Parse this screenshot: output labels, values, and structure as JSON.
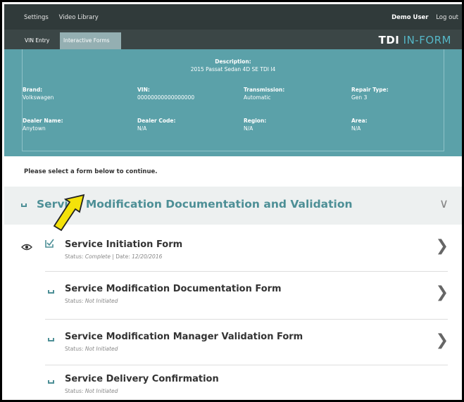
{
  "topbar": {
    "settings": "Settings",
    "video_library": "Video Library",
    "user": "Demo User",
    "logout": "Log out"
  },
  "tabs": {
    "vin_entry": "VIN Entry",
    "interactive_forms": "Interactive Forms"
  },
  "brand": {
    "part1": "TDI",
    "part2": "IN-FORM"
  },
  "vehicle": {
    "description_label": "Description:",
    "description": "2015 Passat Sedan 4D SE TDI I4",
    "brand_label": "Brand:",
    "brand": "Volkswagen",
    "vin_label": "VIN:",
    "vin": "00000000000000000",
    "transmission_label": "Transmission:",
    "transmission": "Automatic",
    "repair_type_label": "Repair Type:",
    "repair_type": "Gen 3",
    "dealer_name_label": "Dealer Name:",
    "dealer_name": "Anytown",
    "dealer_code_label": "Dealer Code:",
    "dealer_code": "N/A",
    "region_label": "Region:",
    "region": "N/A",
    "area_label": "Area:",
    "area": "N/A"
  },
  "prompt": "Please select a form below to continue.",
  "section_title": "Service Modification Documentation and Validation",
  "forms": [
    {
      "title": "Service Initiation Form",
      "status_prefix": "Status:",
      "status": "Complete",
      "date_prefix": "| Date:",
      "date": "12/20/2016"
    },
    {
      "title": "Service Modification Documentation Form",
      "status_prefix": "Status:",
      "status": "Not Initiated"
    },
    {
      "title": "Service Modification Manager Validation Form",
      "status_prefix": "Status:",
      "status": "Not Initiated"
    },
    {
      "title": "Service Delivery Confirmation",
      "status_prefix": "Status:",
      "status": "Not Initiated"
    }
  ],
  "colors": {
    "topbar": "#303a3a",
    "panel": "#5ba1a9",
    "accent": "#4d8f96",
    "annotation_arrow": "#f4e20a"
  }
}
